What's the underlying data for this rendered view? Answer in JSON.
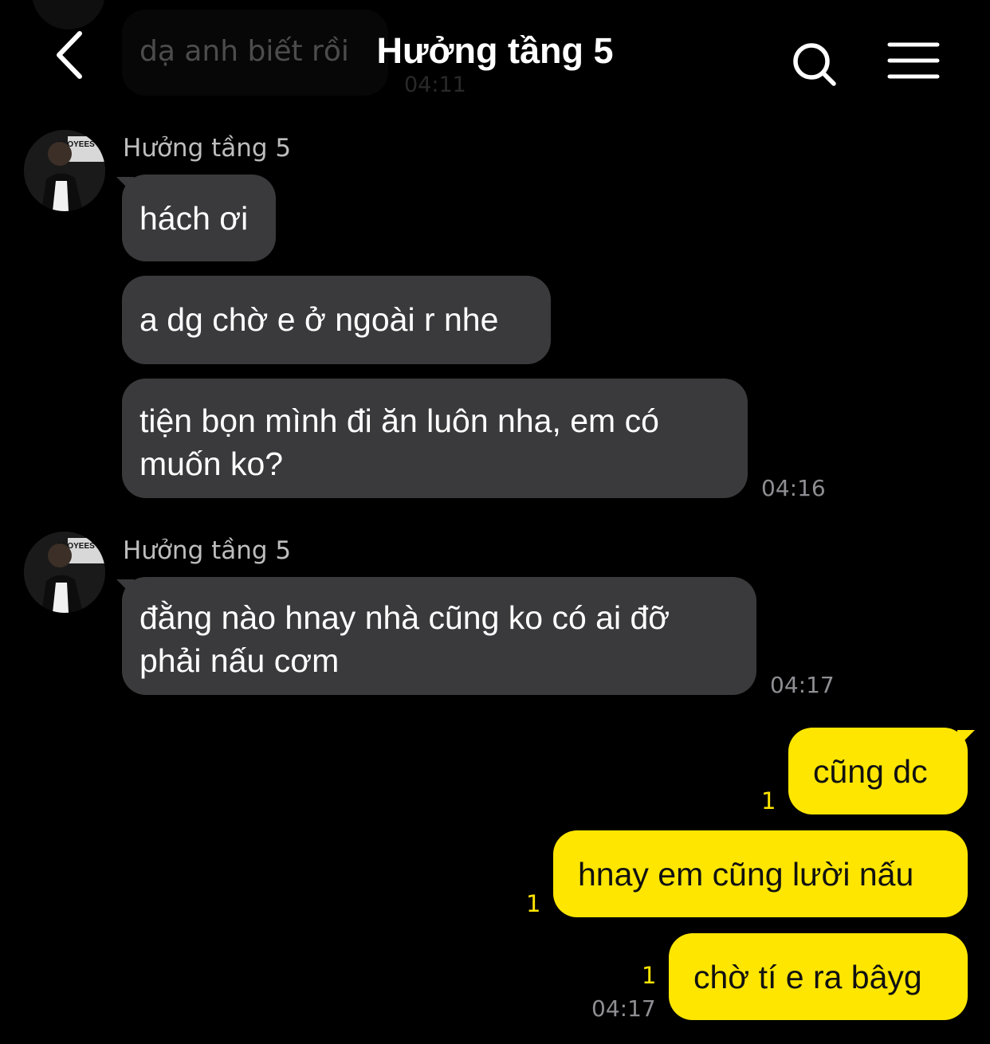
{
  "header": {
    "title": "Hưởng tầng 5"
  },
  "previous": {
    "text": "dạ anh biết rồi",
    "time": "04:11"
  },
  "groups": [
    {
      "sender": "Hưởng tầng 5",
      "messages": [
        "hách ơi",
        "a dg chờ e ở ngoài r nhe",
        "tiện bọn mình đi ăn luôn nha, em có muốn ko?"
      ],
      "time": "04:16"
    },
    {
      "sender": "Hưởng tầng 5",
      "messages": [
        "đằng nào hnay nhà cũng ko có ai đỡ phải nấu cơm"
      ],
      "time": "04:17"
    }
  ],
  "mine": {
    "messages": [
      "cũng dc",
      "hnay em cũng lười nấu",
      "chờ tí e ra bâyg"
    ],
    "unread": [
      "1",
      "1",
      "1"
    ],
    "time": "04:17"
  },
  "avatar": {
    "sign_text": "PLOYEES ONLY"
  }
}
